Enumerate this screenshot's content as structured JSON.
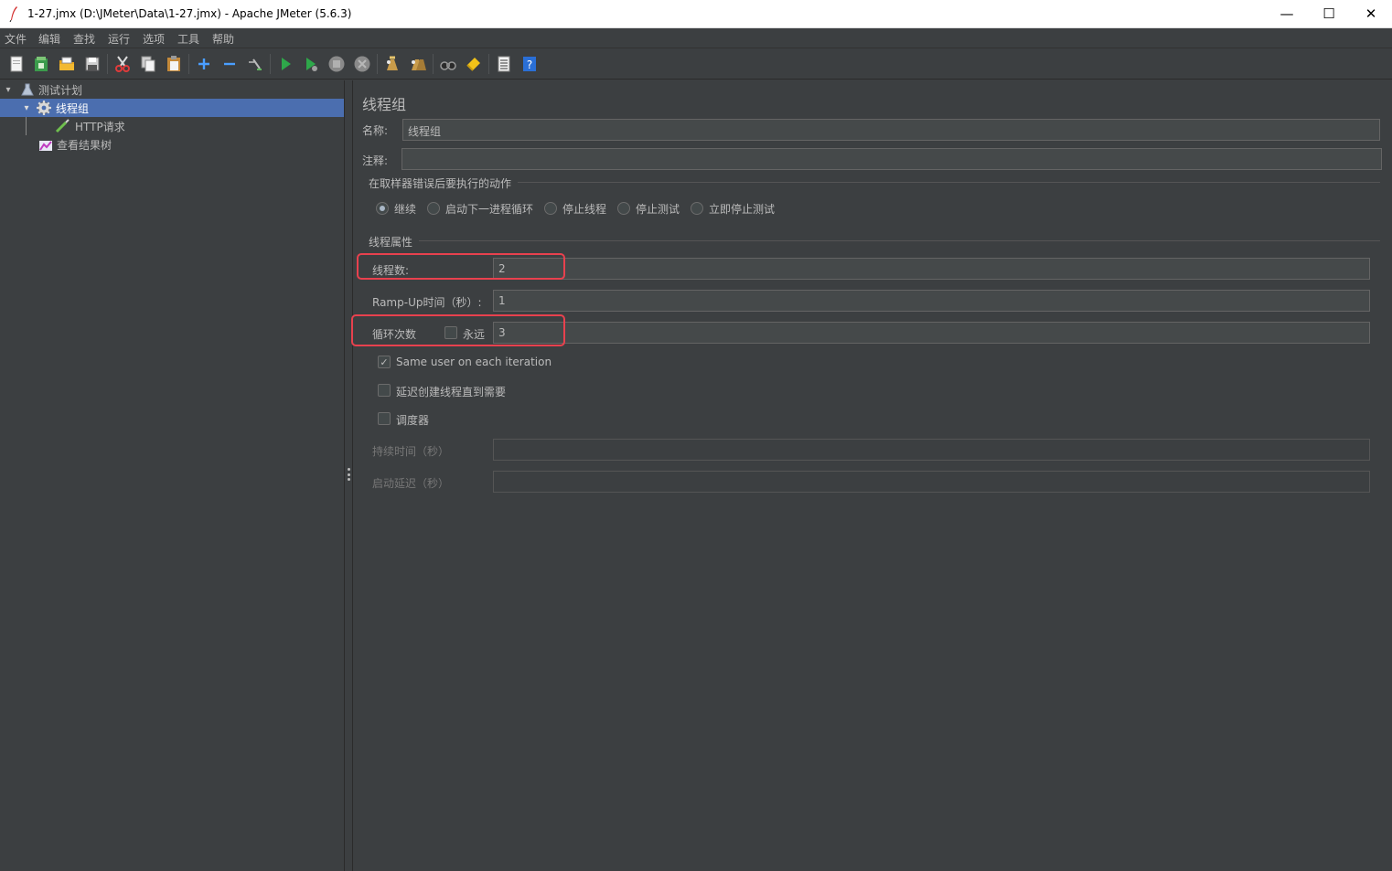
{
  "window": {
    "title": "1-27.jmx (D:\\JMeter\\Data\\1-27.jmx) - Apache JMeter (5.6.3)",
    "minimize": "—",
    "maximize": "☐",
    "close": "✕"
  },
  "menu": [
    "文件",
    "编辑",
    "查找",
    "运行",
    "选项",
    "工具",
    "帮助"
  ],
  "toolbar": {
    "buttons": [
      "new-icon",
      "templates-icon",
      "open-icon",
      "save-icon",
      "cut-icon",
      "copy-icon",
      "paste-icon",
      "expand-icon",
      "collapse-icon",
      "toggle-icon",
      "start-icon",
      "start-no-pause-icon",
      "stop-icon",
      "shutdown-icon",
      "clear-icon",
      "clear-all-icon",
      "search-icon",
      "reset-search-icon",
      "function-helper-icon",
      "help-icon"
    ]
  },
  "tree": {
    "items": [
      {
        "label": "测试计划",
        "icon": "test-plan-icon"
      },
      {
        "label": "线程组",
        "icon": "gear-icon",
        "selected": true
      },
      {
        "label": "HTTP请求",
        "icon": "pipette-icon"
      },
      {
        "label": "查看结果树",
        "icon": "chart-icon"
      }
    ]
  },
  "panel": {
    "title": "线程组",
    "name_label": "名称:",
    "name_value": "线程组",
    "comment_label": "注释:",
    "comment_value": "",
    "error_section_title": "在取样器错误后要执行的动作",
    "error_actions": [
      {
        "label": "继续",
        "checked": true
      },
      {
        "label": "启动下一进程循环",
        "checked": false
      },
      {
        "label": "停止线程",
        "checked": false
      },
      {
        "label": "停止测试",
        "checked": false
      },
      {
        "label": "立即停止测试",
        "checked": false
      }
    ],
    "thread_section_title": "线程属性",
    "threads_label": "线程数:",
    "threads_value": "2",
    "rampup_label": "Ramp-Up时间（秒）:",
    "rampup_value": "1",
    "loop_label": "循环次数",
    "forever_label": "永远",
    "forever_checked": false,
    "loop_value": "3",
    "same_user_label": "Same user on each iteration",
    "same_user_checked": true,
    "delay_label": "延迟创建线程直到需要",
    "delay_checked": false,
    "scheduler_label": "调度器",
    "scheduler_checked": false,
    "duration_label": "持续时间（秒）",
    "duration_value": "",
    "startup_delay_label": "启动延迟（秒）",
    "startup_delay_value": ""
  },
  "colors": {
    "background": "#3c3f41",
    "selection": "#4b6eaf",
    "highlight_box": "#e8414e",
    "text": "#bbbbbb"
  }
}
